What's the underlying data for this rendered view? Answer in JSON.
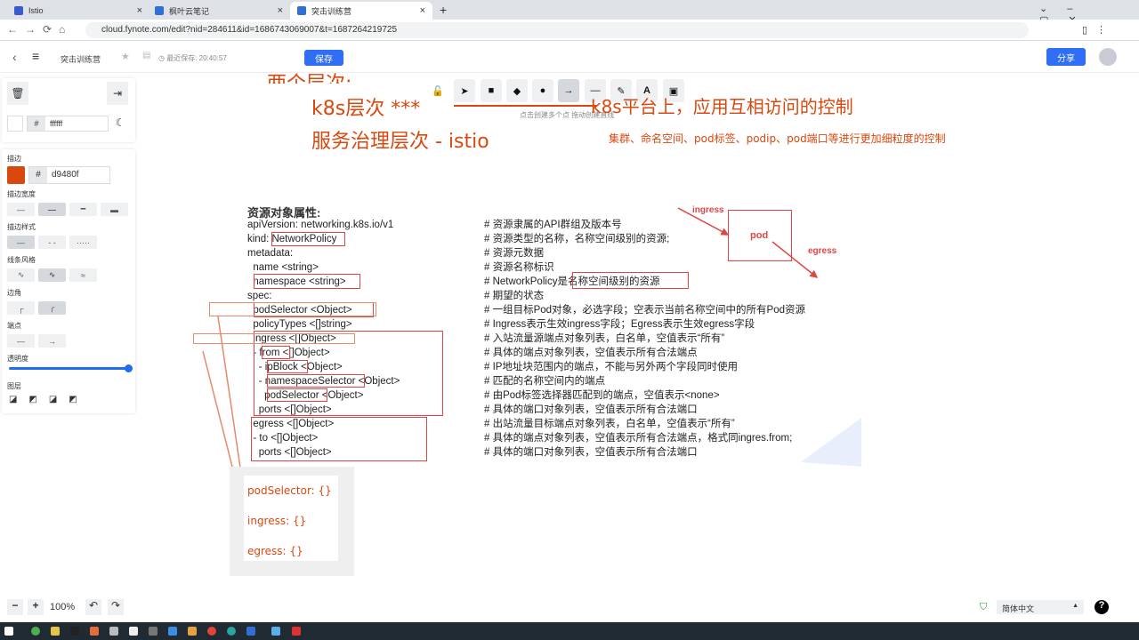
{
  "browser": {
    "tabs": [
      {
        "label": "Istio"
      },
      {
        "label": "枫叶云笔记"
      },
      {
        "label": "突击训练营"
      }
    ],
    "url": "cloud.fynote.com/edit?nid=284611&id=1686743069007&t=1687264219725"
  },
  "header": {
    "doc_title": "突击训练营",
    "save_status": "最近保存: 20:40:57",
    "save_label": "保存",
    "share_label": "分享"
  },
  "panel": {
    "bg_hex": "ffffff",
    "stroke_label": "描边",
    "stroke_hex": "d9480f",
    "stroke_width_label": "描边宽度",
    "stroke_style_label": "描边样式",
    "line_style_label": "线条风格",
    "corner_label": "边角",
    "endpoint_label": "端点",
    "opacity_label": "透明度",
    "opacity": 1.0,
    "layer_label": "图层",
    "hash": "#"
  },
  "toolbar": {
    "hint": "点击创建多个点 拖动创建直线",
    "keys": [
      "1",
      "2",
      "3",
      "4",
      "5",
      "6",
      "7",
      "8",
      "9"
    ]
  },
  "canvas": {
    "title_partial": "两个层次:",
    "line1": "k8s层次 ***",
    "line1_tail": "k8s平台上，应用互相访问的控制",
    "line2": "服务治理层次 - istio",
    "note": "集群、命名空间、pod标签、podip、pod端口等进行更加细粒度的控制",
    "heading": "资源对象属性:",
    "code": [
      "apiVersion: networking.k8s.io/v1",
      "kind: NetworkPolicy",
      "metadata:",
      "  name <string>",
      "  namespace <string>",
      "spec:",
      "  podSelector <Object>",
      "  policyTypes <[]string>",
      "  ingress <[]Object>",
      "  - from <[]Object>",
      "    - ipBlock <Object>",
      "    - namespaceSelector <Object>",
      "      podSelector <Object>",
      "    ports <[]Object>",
      "  egress <[]Object>",
      "  - to <[]Object>",
      "    ports <[]Object>"
    ],
    "comments": [
      "# 资源隶属的API群组及版本号",
      "# 资源类型的名称，名称空间级别的资源;",
      "# 资源元数据",
      "# 资源名称标识",
      "# NetworkPolicy是名称空间级别的资源",
      "# 期望的状态",
      "# 一组目标Pod对象，必选字段；空表示当前名称空间中的所有Pod资源",
      "# Ingress表示生效ingress字段；Egress表示生效egress字段",
      "# 入站流量源端点对象列表，白名单，空值表示“所有”",
      "# 具体的端点对象列表，空值表示所有合法端点",
      "# IP地址块范围内的端点，不能与另外两个字段同时使用",
      "# 匹配的名称空间内的端点",
      "# 由Pod标签选择器匹配到的端点，空值表示<none>",
      "# 具体的端口对象列表，空值表示所有合法端口",
      "# 出站流量目标端点对象列表，白名单，空值表示“所有”",
      "# 具体的端点对象列表，空值表示所有合法端点，格式同ingres.from;",
      "# 具体的端口对象列表，空值表示所有合法端口"
    ],
    "diagram": {
      "ingress": "ingress",
      "pod": "pod",
      "egress": "egress"
    },
    "hand_box": [
      "podSelector: {}",
      "ingress: {}",
      "egress: {}"
    ]
  },
  "footer": {
    "zoom": "100%",
    "language": "简体中文"
  }
}
